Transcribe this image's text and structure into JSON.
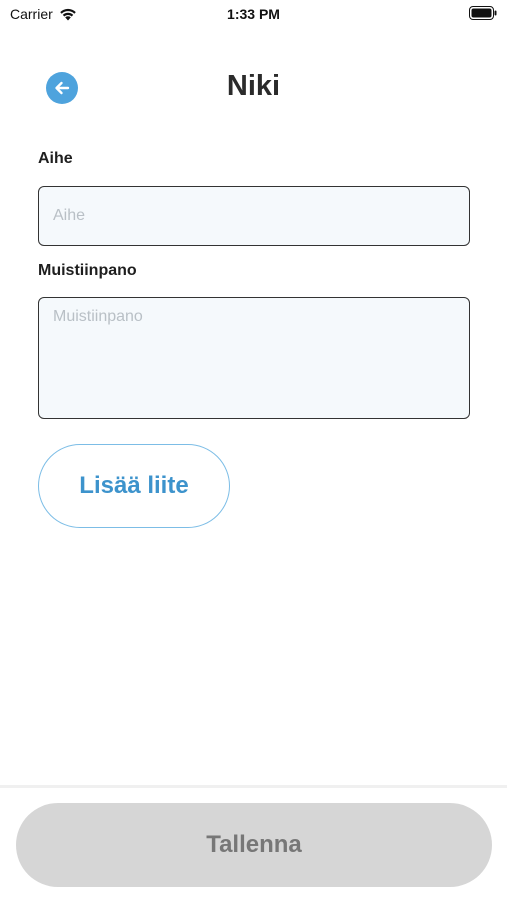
{
  "status_bar": {
    "carrier": "Carrier",
    "time": "1:33 PM"
  },
  "header": {
    "title": "Niki",
    "back_icon": "arrow-left-icon"
  },
  "form": {
    "subject": {
      "label": "Aihe",
      "value": "",
      "placeholder": "Aihe"
    },
    "note": {
      "label": "Muistiinpano",
      "value": "",
      "placeholder": "Muistiinpano"
    },
    "attach_label": "Lisää liite"
  },
  "footer": {
    "save_label": "Tallenna"
  },
  "colors": {
    "accent": "#4ea3dd",
    "input_background": "#f5f9fc",
    "disabled_button": "#d6d6d6"
  }
}
